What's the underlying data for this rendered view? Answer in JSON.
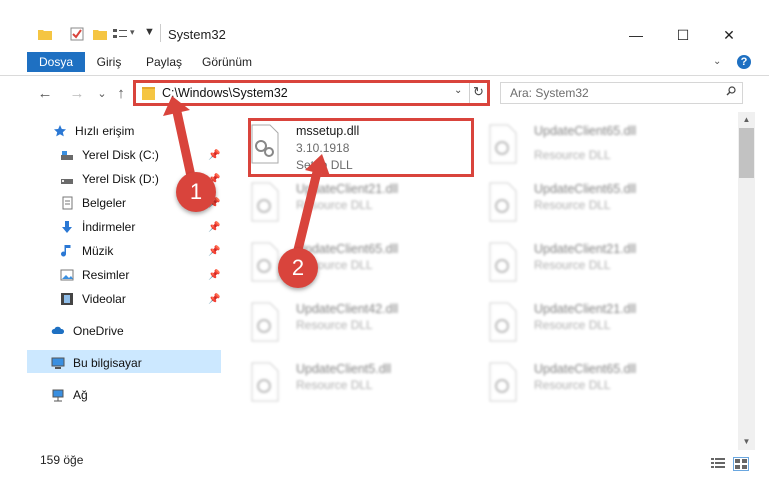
{
  "window": {
    "title": "System32",
    "controls": {
      "minimize": "—",
      "maximize": "☐",
      "close": "✕"
    }
  },
  "ribbon": {
    "tabs": [
      "Dosya",
      "Giriş",
      "Paylaş",
      "Görünüm"
    ],
    "help": "?"
  },
  "navbar": {
    "back": "←",
    "forward": "→",
    "recent": "⌄",
    "up": "↑",
    "address": "C:\\Windows\\System32",
    "search_placeholder": "Ara: System32"
  },
  "sidebar": {
    "items": [
      {
        "label": "Hızlı erişim",
        "icon": "star-icon",
        "pinned": false
      },
      {
        "label": "Yerel Disk (C:)",
        "icon": "drive-icon",
        "pinned": true
      },
      {
        "label": "Yerel Disk (D:)",
        "icon": "drive-icon",
        "pinned": true
      },
      {
        "label": "Belgeler",
        "icon": "documents-icon",
        "pinned": true
      },
      {
        "label": "İndirmeler",
        "icon": "downloads-icon",
        "pinned": true
      },
      {
        "label": "Müzik",
        "icon": "music-icon",
        "pinned": true
      },
      {
        "label": "Resimler",
        "icon": "pictures-icon",
        "pinned": true
      },
      {
        "label": "Videolar",
        "icon": "videos-icon",
        "pinned": true
      },
      {
        "label": "OneDrive",
        "icon": "cloud-icon",
        "pinned": false
      },
      {
        "label": "Bu bilgisayar",
        "icon": "computer-icon",
        "pinned": false,
        "selected": true
      },
      {
        "label": "Ağ",
        "icon": "network-icon",
        "pinned": false
      }
    ]
  },
  "files": [
    {
      "name": "mssetup.dll",
      "version": "3.10.1918",
      "description": "Setup DLL",
      "highlighted": true
    },
    {
      "name": "UpdateClient65.dll",
      "version": "",
      "description": "Resource DLL"
    },
    {
      "name": "UpdateClient21.dll",
      "version": "",
      "description": "Resource DLL"
    },
    {
      "name": "UpdateClient65.dll",
      "version": "",
      "description": "Resource DLL"
    },
    {
      "name": "UpdateClient65.dll",
      "version": "",
      "description": "Resource DLL"
    },
    {
      "name": "UpdateClient21.dll",
      "version": "",
      "description": "Resource DLL"
    },
    {
      "name": "UpdateClient42.dll",
      "version": "",
      "description": "Resource DLL"
    },
    {
      "name": "UpdateClient21.dll",
      "version": "",
      "description": "Resource DLL"
    },
    {
      "name": "UpdateClient5.dll",
      "version": "",
      "description": "Resource DLL"
    },
    {
      "name": "UpdateClient65.dll",
      "version": "",
      "description": "Resource DLL"
    }
  ],
  "status": {
    "item_count": "159 öğe"
  },
  "annotations": {
    "marker1": "1",
    "marker2": "2"
  },
  "colors": {
    "accent": "#1e70c2",
    "highlight_red": "#d9443c",
    "selected_bg": "#cce8ff"
  }
}
